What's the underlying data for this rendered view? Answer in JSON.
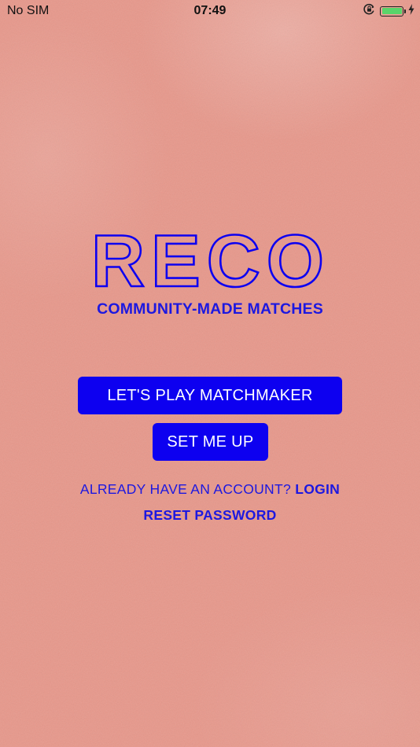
{
  "status_bar": {
    "carrier": "No SIM",
    "time": "07:49",
    "battery_level": 1.0,
    "icons": [
      "orientation-lock-icon",
      "battery-icon",
      "charging-bolt-icon"
    ]
  },
  "logo": {
    "wordmark": "RECO",
    "tagline": "COMMUNITY-MADE MATCHES"
  },
  "actions": {
    "play_label": "LET'S PLAY MATCHMAKER",
    "setup_label": "SET ME UP",
    "account_prompt": "ALREADY HAVE AN ACCOUNT?",
    "login_label": "LOGIN",
    "reset_label": "RESET PASSWORD"
  },
  "colors": {
    "background": "#e8978a",
    "brand_blue": "#0d00f0",
    "text_blue": "#1d18e0",
    "button_text": "#ffffff"
  }
}
